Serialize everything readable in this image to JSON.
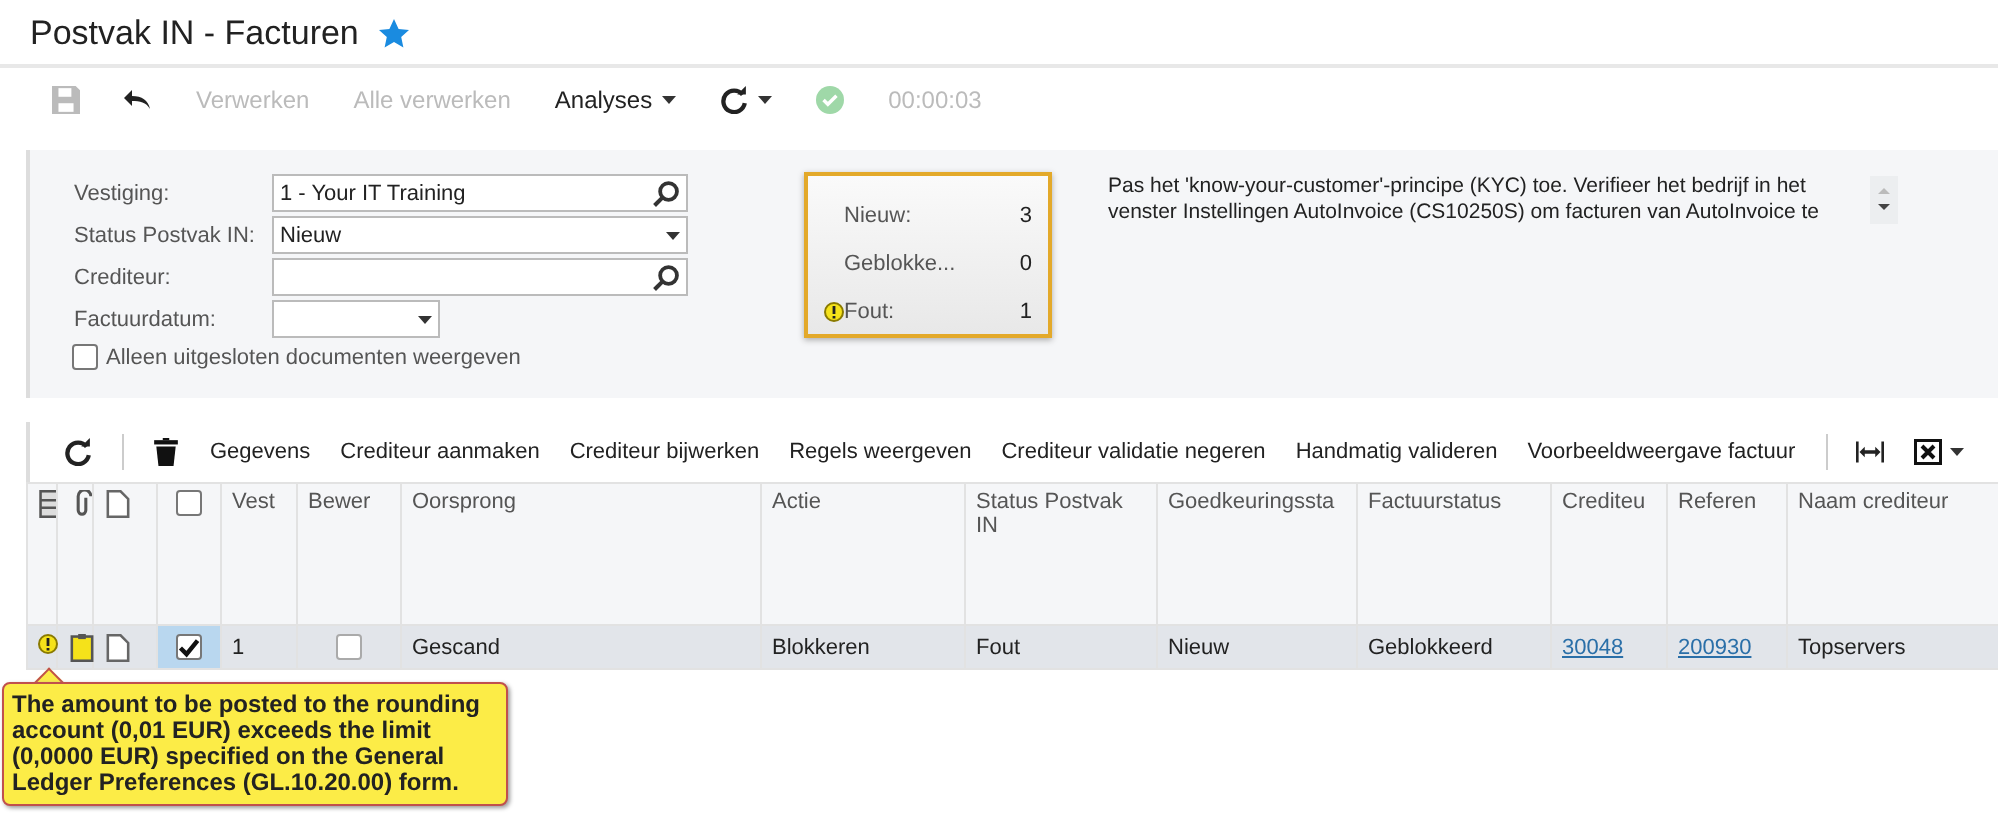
{
  "window": {
    "title": "Postvak IN - Facturen",
    "favorite": true
  },
  "toolbar": [
    {
      "kind": "save",
      "disabled": true
    },
    {
      "kind": "undo",
      "disabled": false
    },
    {
      "kind": "text",
      "label": "Verwerken",
      "disabled": true
    },
    {
      "kind": "text",
      "label": "Alle verwerken",
      "disabled": true
    },
    {
      "kind": "menu",
      "label": "Analyses",
      "disabled": false
    },
    {
      "kind": "refresh",
      "disabled": false
    },
    {
      "kind": "ok",
      "disabled": true
    },
    {
      "kind": "time",
      "label": "00:00:03",
      "disabled": true
    }
  ],
  "filters": [
    {
      "label": "Vestiging:",
      "kind": "lookup",
      "value": "1 - Your IT Training"
    },
    {
      "label": "Status Postvak IN:",
      "kind": "select",
      "value": "Nieuw"
    },
    {
      "label": "Crediteur:",
      "kind": "lookup"
    },
    {
      "label": "Factuurdatum:",
      "kind": "date"
    }
  ],
  "exclude_checkbox": {
    "label": "Alleen uitgesloten documenten weergeven",
    "checked": false
  },
  "counters": [
    {
      "label": "Nieuw:",
      "value": "3",
      "warning": false
    },
    {
      "label": "Geblokke...",
      "value": "0",
      "warning": false
    },
    {
      "label": "Fout:",
      "value": "1",
      "warning": true
    }
  ],
  "notice": "Pas het 'know-your-customer'-principe (KYC) toe. Verifieer het bedrijf in het venster Instellingen AutoInvoice (CS10250S) om facturen van AutoInvoice te",
  "grid_toolbar": [
    {
      "kind": "refresh"
    },
    {
      "kind": "delete"
    },
    {
      "kind": "text",
      "label": "Gegevens"
    },
    {
      "kind": "text",
      "label": "Crediteur aanmaken"
    },
    {
      "kind": "text",
      "label": "Crediteur bijwerken"
    },
    {
      "kind": "text",
      "label": "Regels weergeven"
    },
    {
      "kind": "text",
      "label": "Crediteur validatie negeren"
    },
    {
      "kind": "text",
      "label": "Handmatig valideren"
    },
    {
      "kind": "text",
      "label": "Voorbeeldweergave factuur"
    },
    {
      "kind": "fit"
    },
    {
      "kind": "excel"
    }
  ],
  "table": {
    "columns": [
      {
        "kind": "files"
      },
      {
        "kind": "attach"
      },
      {
        "kind": "doc"
      },
      {
        "kind": "check"
      },
      {
        "kind": "text",
        "label": "Vest"
      },
      {
        "kind": "text",
        "label": "Bewer"
      },
      {
        "kind": "text",
        "label": "Oorsprong"
      },
      {
        "kind": "text",
        "label": "Actie"
      },
      {
        "kind": "text",
        "label": "Status Postvak IN"
      },
      {
        "kind": "text",
        "label": "Goedkeuringssta"
      },
      {
        "kind": "text",
        "label": "Factuurstatus"
      },
      {
        "kind": "text",
        "label": "Crediteu"
      },
      {
        "kind": "text",
        "label": "Referen"
      },
      {
        "kind": "text",
        "label": "Naam crediteur"
      }
    ],
    "header_checkbox": {
      "checked": false
    },
    "rows": [
      {
        "selected": true,
        "warning": true,
        "checked": true,
        "vest": "1",
        "edited": false,
        "origin": "Gescand",
        "action": "Blokkeren",
        "status": "Fout",
        "approval": "Nieuw",
        "invoice_status": "Geblokkeerd",
        "vendor": "30048",
        "reference": "200930",
        "vendor_name": "Topservers"
      }
    ]
  },
  "tooltip": "The amount to be posted to the rounding account (0,01 EUR) exceeds the limit (0,0000 EUR) specified on the General Ledger Preferences (GL.10.20.00) form."
}
